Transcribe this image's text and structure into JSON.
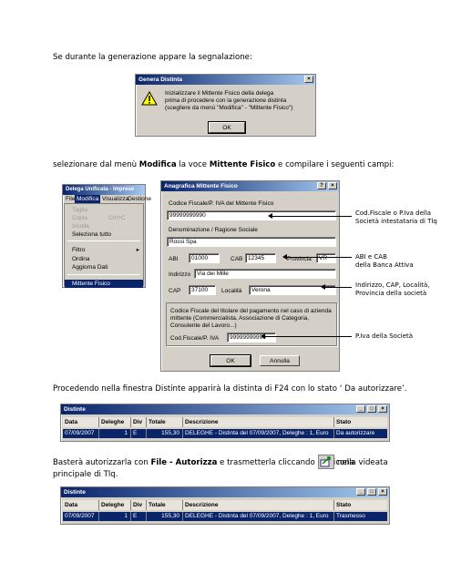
{
  "text": {
    "p1": "Se durante la generazione appare la segnalazione:",
    "p2a": "selezionare dal menù ",
    "p2b": "Modifica",
    "p2c": " la voce ",
    "p2d": "Mittente Fisico",
    "p2e": " e compilare i seguenti campi:",
    "p3": "Procedendo nella finestra Distinte apparirà la distinta di F24 con lo stato ‘ Da autorizzare’.",
    "p4a": "Basterà autorizzarla con ",
    "p4b": "File - Autorizza",
    "p4c": " e trasmetterla cliccando sull’icona",
    "p4d": "nella videata",
    "p4e": "principale di Tlq."
  },
  "dialog": {
    "title": "Genera Distinta",
    "msg1": "Inizializzare il Mittente Fisico della delega",
    "msg2": "prima di procedere con la generazione distinta",
    "msg3": "(scegliere da menù \"Modifica\" - \"Mittente Fisico\")",
    "ok": "OK"
  },
  "menuwin": {
    "title": "Delega Unificata - Imprese",
    "menus": [
      "File",
      "Modifica",
      "Visualizza",
      "Gestione"
    ],
    "items": [
      "Taglia",
      "Copia",
      "Incolla",
      "Seleziona tutto",
      "Filtro",
      "Ordina",
      "Aggiorna Dati",
      "Mittente Fisico"
    ],
    "shortcut": "Ctrl+C"
  },
  "form": {
    "title": "Anagrafica Mittente Fisico",
    "codice_label": "Codice Fiscale/P. IVA del Mittente Fisico",
    "codice_value": "99999999990",
    "denom_label": "Denominazione / Ragione Sociale",
    "denom_value": "Rossi Spa",
    "abi_label": "ABI",
    "abi_value": "01000",
    "cab_label": "CAB",
    "cab_value": "12345",
    "prov_label": "Provincia",
    "prov_value": "VR",
    "ind_label": "Indirizzo",
    "ind_value": "Via dei Mille",
    "cap_label": "CAP",
    "cap_value": "37100",
    "loc_label": "Località",
    "loc_value": "Verona",
    "note1": "Codice Fiscale del titolare del pagamento nel caso di azienda",
    "note2": "mittente (Commercialista, Associazione di Categoria,",
    "note3": "Consulente del Lavoro...)",
    "cf_label": "Cod.Fiscale/P. IVA",
    "cf_value": "99999999990",
    "ok": "OK",
    "annulla": "Annulla"
  },
  "annotations": {
    "a1": "Cod.Fiscale o P.Iva della",
    "a1b": "Società intestataria di Tlq",
    "a2": "ABI e CAB",
    "a2b": "della Banca Attiva",
    "a3": "Indirizzo, CAP, Località,",
    "a3b": "Provincia della società",
    "a4": "P.Iva della Società"
  },
  "distinte1": {
    "title": "Distinte",
    "headers": [
      "Data",
      "Deleghe",
      "Div",
      "Totale",
      "Descrizione",
      "Stato"
    ],
    "row": [
      "07/09/2007",
      "1",
      "E",
      "155,30",
      "DELEGHE - Distinta del 07/09/2007, Deleghe : 1, Euro",
      "Da autorizzare"
    ]
  },
  "distinte2": {
    "title": "Distinte",
    "headers": [
      "Data",
      "Deleghe",
      "Div",
      "Totale",
      "Descrizione",
      "Stato"
    ],
    "row": [
      "07/09/2007",
      "1",
      "E",
      "155,30",
      "DELEGHE - Distinta del 07/09/2007, Deleghe : 1, Euro",
      "Trasmesso"
    ]
  },
  "colors": {
    "titlebar": "#0a246a",
    "window": "#d4d0c8",
    "selection": "#0a246a"
  }
}
